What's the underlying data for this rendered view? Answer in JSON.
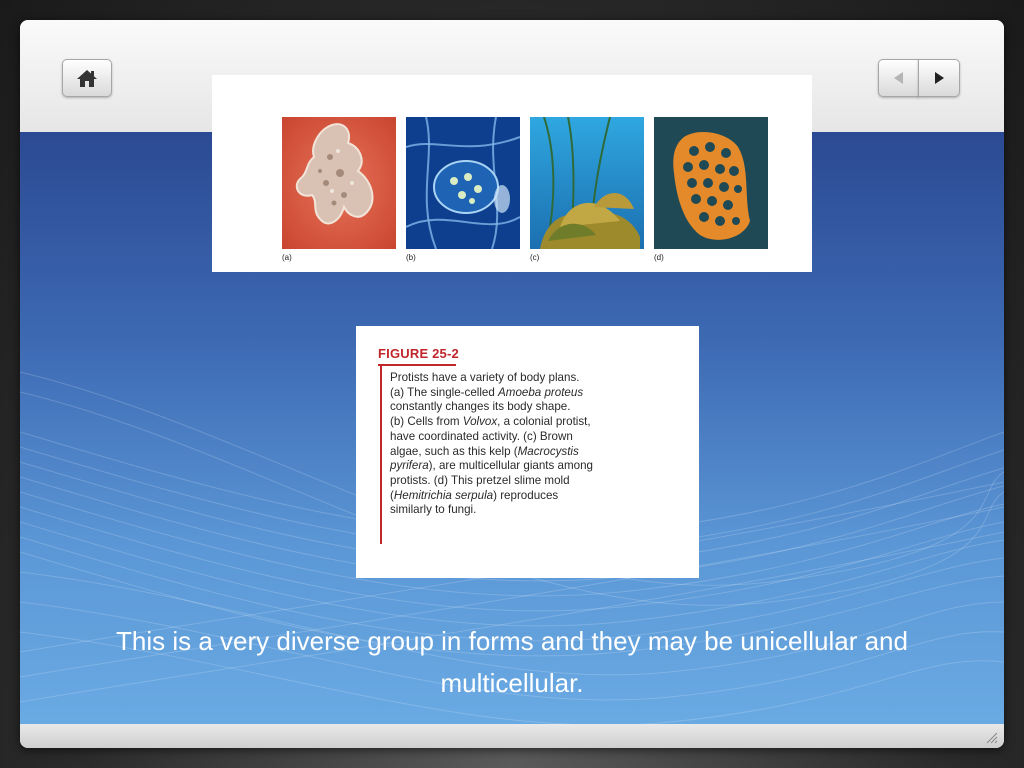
{
  "nav": {
    "home_icon": "home-icon",
    "prev_icon": "triangle-left-icon",
    "next_icon": "triangle-right-icon"
  },
  "photos": {
    "panels": [
      {
        "label": "(a)"
      },
      {
        "label": "(b)"
      },
      {
        "label": "(c)"
      },
      {
        "label": "(d)"
      }
    ]
  },
  "figure": {
    "title": "FIGURE 25-2",
    "lines": [
      "Protists have a variety of body plans.",
      "(a) The single-celled ",
      "Amoeba proteus",
      "constantly changes its body shape.",
      "(b) Cells from ",
      "Volvox",
      ", a colonial protist,",
      "have coordinated activity. (c) Brown",
      "algae, such as this kelp (",
      "Macrocystis",
      "pyrifera",
      "), are multicellular giants among",
      "protists. (d) This pretzel slime mold",
      "(",
      "Hemitrichia serpula",
      ") reproduces",
      "similarly to fungi."
    ]
  },
  "slide_text": "This is a very diverse group in forms and they may be unicellular and multicellular.",
  "colors": {
    "accent_red": "#c0262c",
    "blue_top": "#2b4a93",
    "blue_bottom": "#6aaae3"
  }
}
